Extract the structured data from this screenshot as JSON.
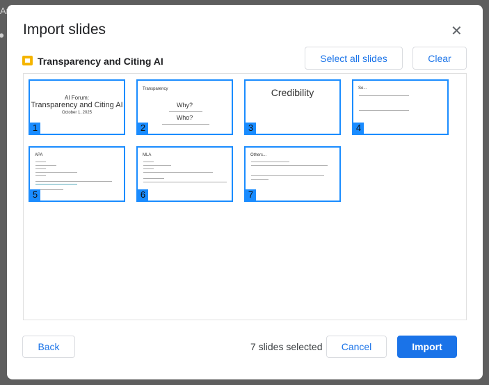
{
  "dialog": {
    "title": "Import slides",
    "close_icon": "close-icon"
  },
  "presentation": {
    "name": "Transparency and Citing AI",
    "icon": "google-slides-icon",
    "icon_color": "#fbbc04"
  },
  "buttons": {
    "select_all": "Select all slides",
    "clear": "Clear",
    "back": "Back",
    "cancel": "Cancel",
    "import": "Import"
  },
  "status": "7 slides selected",
  "accent": "#1a73e8",
  "slides": [
    {
      "number": "1",
      "lines": [
        "AI Forum:",
        "Transparency and Citing AI",
        "October 1, 2025"
      ]
    },
    {
      "number": "2",
      "lines": [
        "Transparency",
        "Why?",
        "Who?"
      ]
    },
    {
      "number": "3",
      "lines": [
        "Credibility"
      ]
    },
    {
      "number": "4",
      "lines": [
        "So..."
      ]
    },
    {
      "number": "5",
      "lines": [
        "APA"
      ]
    },
    {
      "number": "6",
      "lines": [
        "MLA"
      ]
    },
    {
      "number": "7",
      "lines": [
        "Others..."
      ]
    }
  ]
}
